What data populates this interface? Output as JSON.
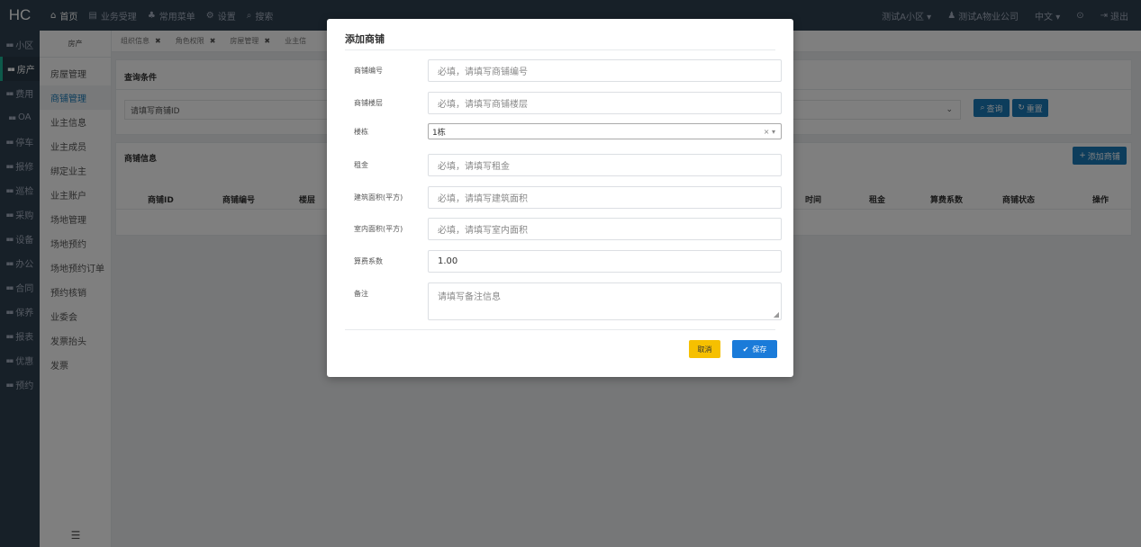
{
  "app": {
    "logo": "HC",
    "topnav": [
      {
        "icon": "home-icon",
        "glyph": "⌂",
        "label": "首页"
      },
      {
        "icon": "document-icon",
        "glyph": "▤",
        "label": "业务受理"
      },
      {
        "icon": "sitemap-icon",
        "glyph": "♣",
        "label": "常用菜单"
      },
      {
        "icon": "gear-icon",
        "glyph": "⚙",
        "label": "设置"
      },
      {
        "icon": "search-icon",
        "glyph": "⌕",
        "label": "搜索"
      }
    ],
    "topright": {
      "community": "测试A小区 ▾",
      "company": "测试A物业公司",
      "language": "中文 ▾",
      "help": "⊙",
      "logout": "退出"
    }
  },
  "sidebar": {
    "items": [
      {
        "label": "小区"
      },
      {
        "label": "房产"
      },
      {
        "label": "费用"
      },
      {
        "label": "OA"
      },
      {
        "label": "停车"
      },
      {
        "label": "报修"
      },
      {
        "label": "巡检"
      },
      {
        "label": "采购"
      },
      {
        "label": "设备"
      },
      {
        "label": "办公"
      },
      {
        "label": "合同"
      },
      {
        "label": "保养"
      },
      {
        "label": "报表"
      },
      {
        "label": "优惠"
      },
      {
        "label": "预约"
      }
    ],
    "active_index": 1
  },
  "subside": {
    "head": "房产",
    "items": [
      "房屋管理",
      "商铺管理",
      "业主信息",
      "业主成员",
      "绑定业主",
      "业主账户",
      "场地管理",
      "场地预约",
      "场地预约订单",
      "预约核销",
      "业委会",
      "发票抬头",
      "发票"
    ],
    "active_index": 1,
    "foot": "☰"
  },
  "tabs": [
    {
      "label": "组织信息"
    },
    {
      "label": "角色权限"
    },
    {
      "label": "房屋管理"
    },
    {
      "label": "业主信"
    }
  ],
  "query": {
    "title": "查询条件",
    "placeholder": "请填写商铺ID",
    "query_btn": "查询",
    "reset_btn": "重置"
  },
  "list": {
    "title": "商铺信息",
    "add_btn": "添加商铺",
    "columns": [
      "商铺ID",
      "商铺编号",
      "楼层",
      "时间",
      "租金",
      "算费系数",
      "商铺状态",
      "操作"
    ]
  },
  "modal": {
    "title": "添加商铺",
    "fields": [
      {
        "label": "商铺编号",
        "placeholder": "必填，请填写商铺编号"
      },
      {
        "label": "商铺楼层",
        "placeholder": "必填，请填写商铺楼层"
      },
      {
        "label": "楼栋",
        "value": "1栋"
      },
      {
        "label": "租金",
        "placeholder": "必填，请填写租金"
      },
      {
        "label": "建筑面积(平方)",
        "placeholder": "必填，请填写建筑面积"
      },
      {
        "label": "室内面积(平方)",
        "placeholder": "必填，请填写室内面积"
      },
      {
        "label": "算费系数",
        "value": "1.00"
      },
      {
        "label": "备注",
        "placeholder": "请填写备注信息"
      }
    ],
    "cancel": "取消",
    "save": "保存"
  }
}
